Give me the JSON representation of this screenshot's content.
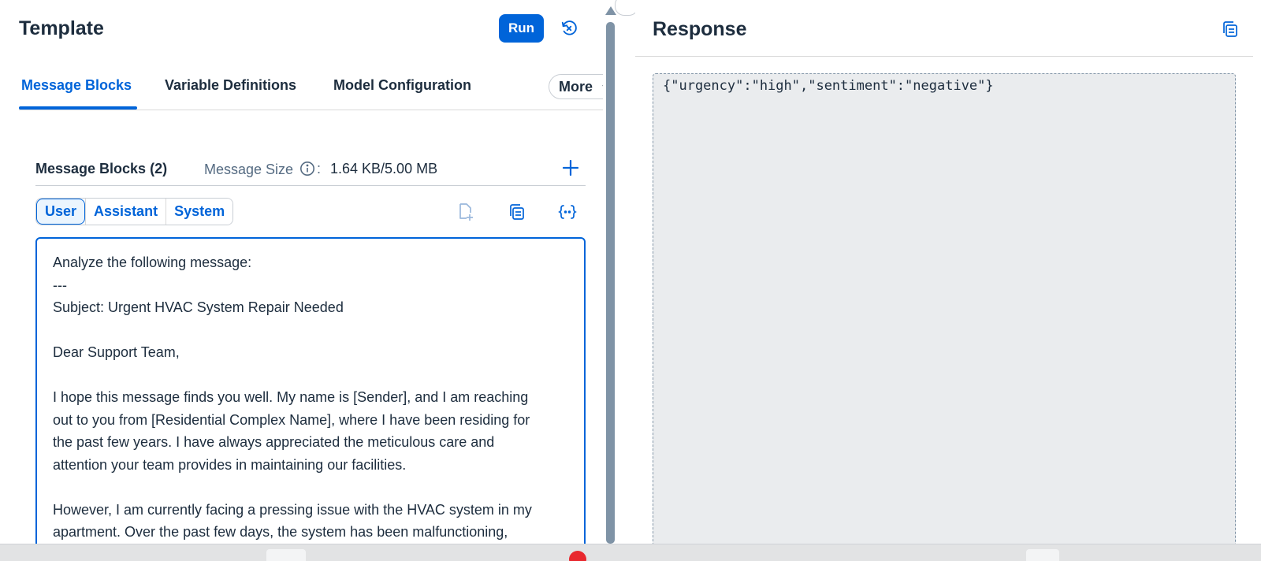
{
  "template": {
    "title": "Template",
    "run_label": "Run",
    "tabs": [
      {
        "label": "Message Blocks"
      },
      {
        "label": "Variable Definitions"
      },
      {
        "label": "Model Configuration"
      }
    ],
    "more_label": "More",
    "message_blocks": {
      "title": "Message Blocks (2)",
      "size_label": "Message Size",
      "colon": ":",
      "size_value": "1.64 KB/5.00 MB",
      "roles": [
        {
          "label": "User"
        },
        {
          "label": "Assistant"
        },
        {
          "label": "System"
        }
      ],
      "content_lines": [
        "Analyze the following message:",
        "---",
        "Subject: Urgent HVAC System Repair Needed",
        "",
        "Dear Support Team,",
        "",
        "I hope this message finds you well. My name is [Sender], and I am reaching",
        "out to you from [Residential Complex Name], where I have been residing for",
        "the past few years. I have always appreciated the meticulous care and",
        "attention your team provides in maintaining our facilities.",
        "",
        "However, I am currently facing a pressing issue with the HVAC system in my",
        "apartment. Over the past few days, the system has been malfunctioning,"
      ]
    }
  },
  "response": {
    "title": "Response",
    "content": "{\"urgency\":\"high\",\"sentiment\":\"negative\"}"
  },
  "icons": {
    "reset": "reset-icon",
    "info": "info-icon",
    "add": "plus-icon",
    "add_block": "add-block-icon",
    "copy": "copy-icon",
    "variable": "variable-icon",
    "chevron": "chevron-down-icon"
  },
  "colors": {
    "accent": "#0064d9",
    "text": "#1d2d3e",
    "muted": "#556b82",
    "response_bg": "#eaecee"
  }
}
